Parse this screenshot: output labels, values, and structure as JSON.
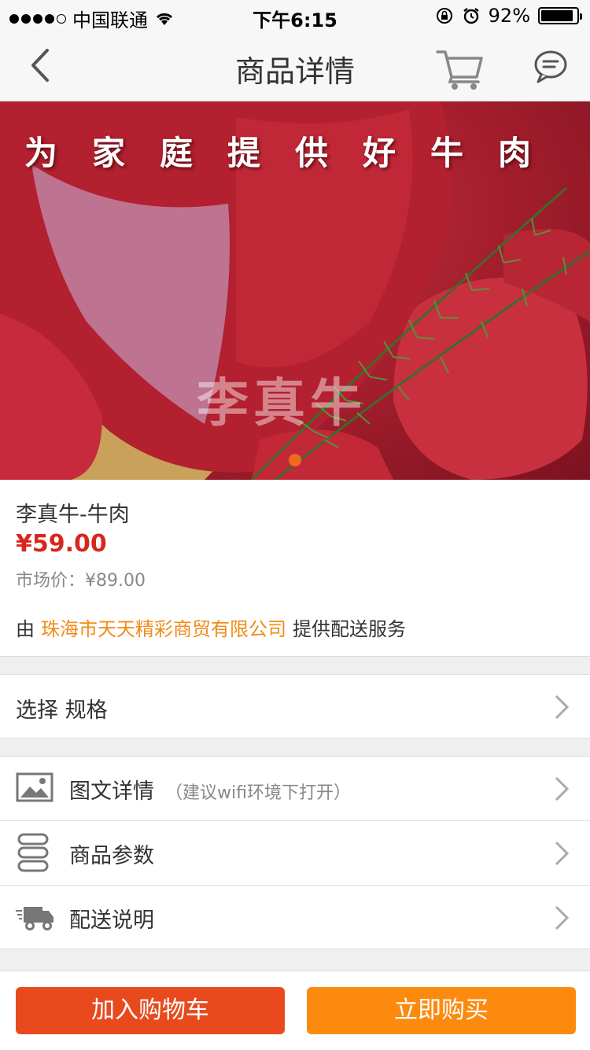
{
  "status_bar": {
    "carrier": "中国联通",
    "time": "下午6:15",
    "battery": "92%",
    "battery_level": 0.92
  },
  "nav": {
    "title": "商品详情",
    "back_icon": "chevron-left-icon",
    "cart_icon": "cart-icon",
    "message_icon": "chat-bubble-icon"
  },
  "banner": {
    "slogan": "为家庭提供好牛肉",
    "watermark": "李真牛",
    "page_count": 1,
    "active_page": 1,
    "accent": "#f06a1f"
  },
  "product": {
    "name": "李真牛-牛肉",
    "price": "¥59.00",
    "market_label": "市场价：",
    "market_price": "¥89.00",
    "vendor_prefix": "由",
    "vendor_company": "珠海市天天精彩商贸有限公司",
    "vendor_suffix": "提供配送服务",
    "price_color": "#d9261c",
    "company_color": "#f08c18"
  },
  "spec_row": {
    "label": "选择 规格"
  },
  "detail_rows": [
    {
      "label": "图文详情",
      "hint": "（建议wifi环境下打开）",
      "icon": "image-icon"
    },
    {
      "label": "商品参数",
      "icon": "list-icon"
    },
    {
      "label": "配送说明",
      "icon": "truck-icon"
    }
  ],
  "actions": {
    "add_to_cart": "加入购物车",
    "buy_now": "立即购买",
    "add_color": "#e84a1e",
    "buy_color": "#fb8a0e"
  }
}
